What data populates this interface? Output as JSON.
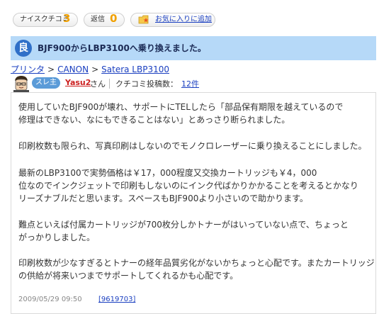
{
  "header_buttons": {
    "nice_label": "ナイスクチコミ",
    "nice_count": "3",
    "reply_label": "返信",
    "reply_count": "0",
    "favorite_label": "お気に入りに追加"
  },
  "review": {
    "grade": "良",
    "title": "BJF900からLBP3100へ乗り換えました。"
  },
  "breadcrumb": [
    "プリンタ",
    "CANON",
    "Satera LBP3100"
  ],
  "user": {
    "badge": "スレ主",
    "name": "Yasu2",
    "suffix": "さん",
    "post_count_label": "クチコミ投稿数：",
    "post_count": "12件"
  },
  "body": {
    "paragraphs": [
      [
        "使用していたBJF900が壊れ、サポートにTELしたら「部品保有期限を越えているので",
        "修理はできない、なにもできることはない」とあっさり断られました。"
      ],
      [
        "印刷枚数も限られ、写真印刷はしないのでモノクロレーザーに乗り換えることにしました。"
      ],
      [
        "最新のLBP3100で実勢価格は￥17，000程度又交換カートリッジも￥4，000",
        "位なのでインクジェットで印刷もしないのにインク代ばかりかかることを考えるとかなり",
        "リーズナブルだと思います。スペースもBJF900より小さいので助かります。"
      ],
      [
        "難点といえば付属カートリッジが700枚分しかトナーがはいっていない点で、ちょっと",
        "がっかりしました。"
      ],
      [
        "印刷枚数が少なすぎるとトナーの経年品質劣化がないかちょっと心配です。またカートリッジ",
        "の供給が将来いつまでサポートしてくれるかも心配です。"
      ]
    ],
    "date": "2009/05/29 09:50",
    "post_id": "[9619703]"
  },
  "colors": {
    "title_bar_bg": "#b6d9f8",
    "grade_badge_bg": "#2f6fc8",
    "count_accent": "#f0a000",
    "link": "#1a3fc0",
    "username": "#cc1f1f"
  },
  "icons": {
    "favorite": "folder-star-icon",
    "avatar": "user-avatar-icon"
  }
}
